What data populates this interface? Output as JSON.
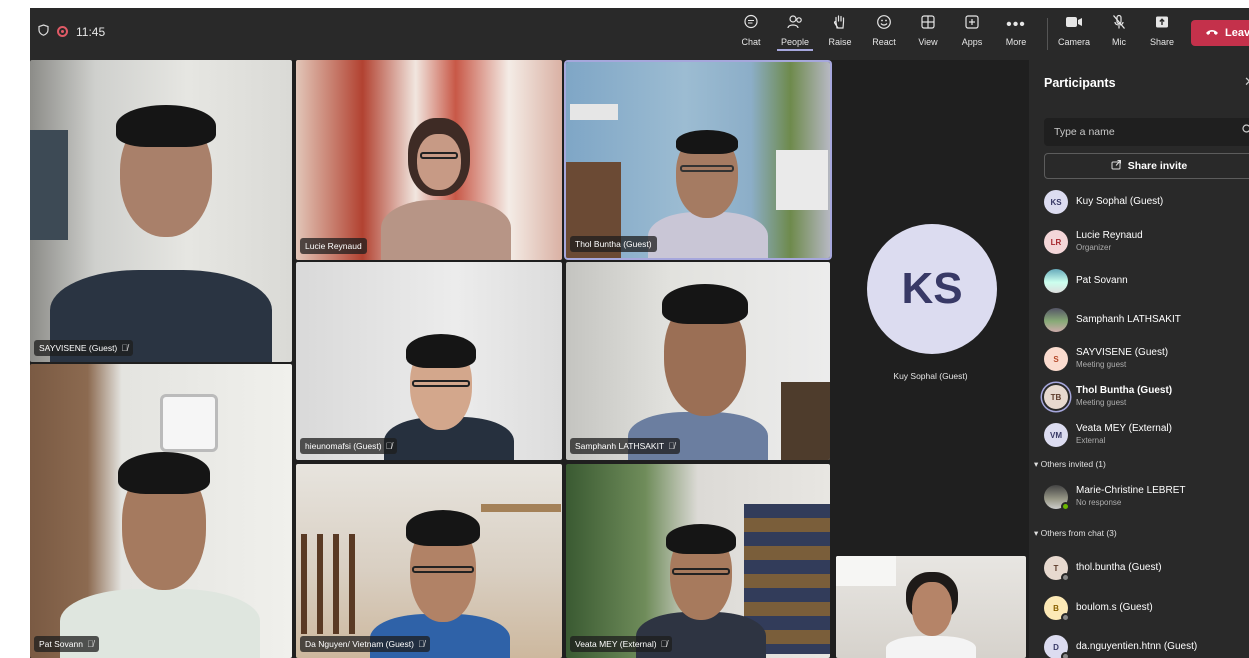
{
  "topbar": {
    "time": "11:45",
    "buttons": {
      "chat": "Chat",
      "people": "People",
      "raise": "Raise",
      "react": "React",
      "view": "View",
      "apps": "Apps",
      "more": "More",
      "camera": "Camera",
      "mic": "Mic",
      "share": "Share",
      "leave": "Leave"
    }
  },
  "tiles": [
    {
      "name": "SAYVISENE (Guest)",
      "muted": true
    },
    {
      "name": "Lucie Reynaud",
      "muted": false
    },
    {
      "name": "Thol Buntha (Guest)",
      "muted": false
    },
    {
      "name": "hieunomafsi (Guest)",
      "muted": true
    },
    {
      "name": "Samphanh LATHSAKIT",
      "muted": true
    },
    {
      "name": "Pat Sovann",
      "muted": true
    },
    {
      "name": "Da Nguyen/ Vietnam (Guest)",
      "muted": true
    },
    {
      "name": "Veata MEY (External)",
      "muted": true
    }
  ],
  "placeholder_tile": {
    "initials": "KS",
    "name": "Kuy Sophal (Guest)"
  },
  "panel": {
    "title": "Participants",
    "search_placeholder": "Type a name",
    "share_invite": "Share invite",
    "participants": [
      {
        "initials": "KS",
        "name": "Kuy Sophal (Guest)",
        "sub": ""
      },
      {
        "initials": "LR",
        "name": "Lucie Reynaud",
        "sub": "Organizer"
      },
      {
        "initials": "",
        "name": "Pat Sovann",
        "sub": ""
      },
      {
        "initials": "",
        "name": "Samphanh LATHSAKIT",
        "sub": ""
      },
      {
        "initials": "S",
        "name": "SAYVISENE (Guest)",
        "sub": "Meeting guest"
      },
      {
        "initials": "TB",
        "name": "Thol Buntha (Guest)",
        "sub": "Meeting guest"
      },
      {
        "initials": "VM",
        "name": "Veata MEY (External)",
        "sub": "External"
      }
    ],
    "others_invited_label": "Others invited (1)",
    "others_invited": [
      {
        "name": "Marie-Christine LEBRET",
        "sub": "No response"
      }
    ],
    "others_chat_label": "Others from chat (3)",
    "others_chat": [
      {
        "initials": "T",
        "name": "thol.buntha (Guest)"
      },
      {
        "initials": "B",
        "name": "boulom.s (Guest)"
      },
      {
        "initials": "D",
        "name": "da.nguyentien.htnn (Guest)"
      }
    ]
  },
  "colors": {
    "leave": "#c4314b",
    "accent": "#a6a7dc",
    "avatar_bg": "#dcdcf0"
  }
}
